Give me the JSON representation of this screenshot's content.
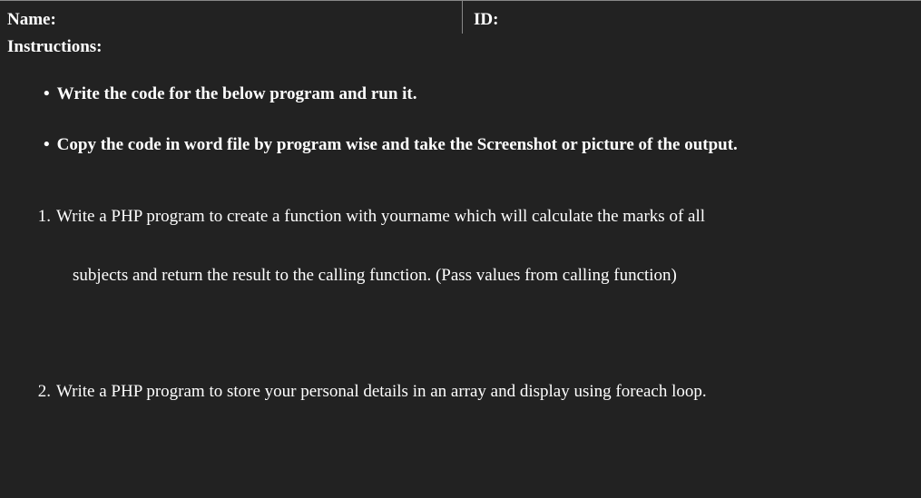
{
  "header": {
    "name_label": "Name:",
    "id_label": "ID:"
  },
  "instructions_label": "Instructions:",
  "bullets": [
    "Write the code for the below program and run it.",
    "Copy the code in word file by program wise and take the Screenshot or picture of the output."
  ],
  "questions": [
    {
      "num": "1.",
      "line1": "Write a PHP program to create a function with yourname which will calculate the marks of all",
      "line2": "subjects and return the result to the calling function. (Pass values from calling function)"
    },
    {
      "num": "2.",
      "line1": "Write a PHP program to store your personal details in an array and display using foreach loop."
    }
  ]
}
